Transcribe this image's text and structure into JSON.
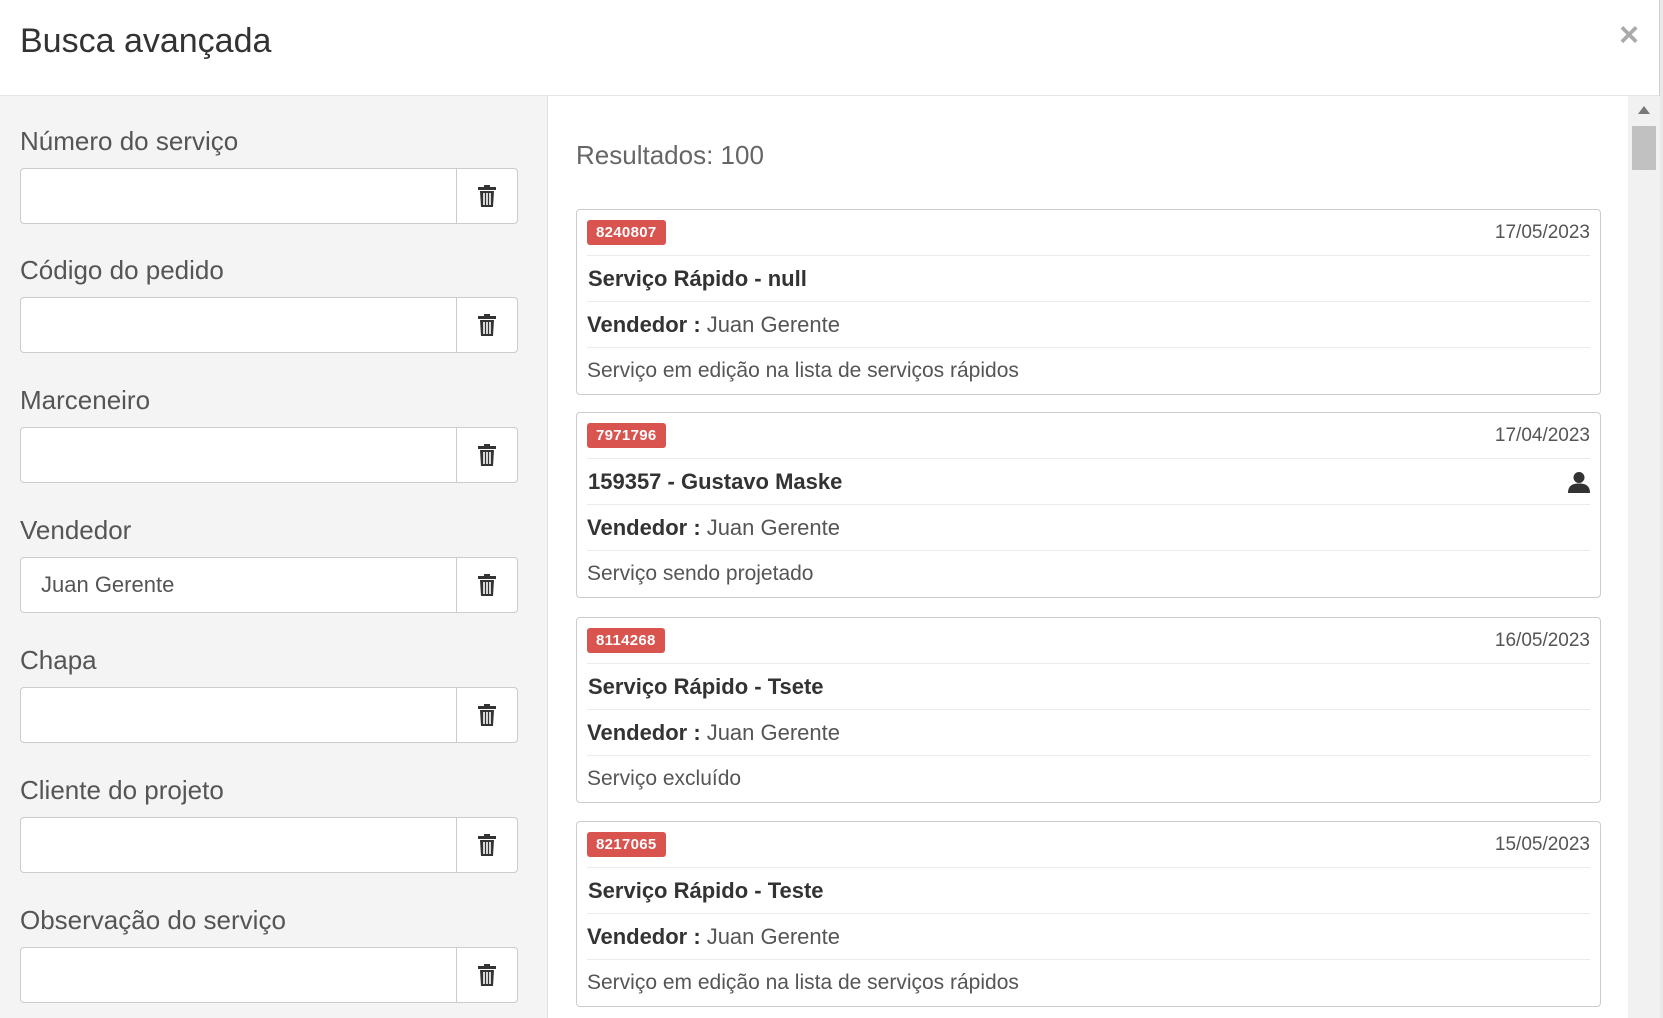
{
  "modal": {
    "title": "Busca avançada",
    "close_label": "×"
  },
  "filters": [
    {
      "label": "Número do serviço",
      "value": ""
    },
    {
      "label": "Código do pedido",
      "value": ""
    },
    {
      "label": "Marceneiro",
      "value": ""
    },
    {
      "label": "Vendedor",
      "value": "Juan Gerente"
    },
    {
      "label": "Chapa",
      "value": ""
    },
    {
      "label": "Cliente do projeto",
      "value": ""
    },
    {
      "label": "Observação do serviço",
      "value": ""
    }
  ],
  "results": {
    "count_label": "Resultados: 100",
    "seller_label": "Vendedor :",
    "items": [
      {
        "id": "8240807",
        "date": "17/05/2023",
        "title": "Serviço Rápido - null",
        "seller": "Juan Gerente",
        "status": "Serviço em edição na lista de serviços rápidos",
        "user_icon": false
      },
      {
        "id": "7971796",
        "date": "17/04/2023",
        "title": "159357 - Gustavo Maske",
        "seller": "Juan Gerente",
        "status": "Serviço sendo projetado",
        "user_icon": true
      },
      {
        "id": "8114268",
        "date": "16/05/2023",
        "title": "Serviço Rápido - Tsete",
        "seller": "Juan Gerente",
        "status": "Serviço excluído",
        "user_icon": false
      },
      {
        "id": "8217065",
        "date": "15/05/2023",
        "title": "Serviço Rápido - Teste",
        "seller": "Juan Gerente",
        "status": "Serviço em edição na lista de serviços rápidos",
        "user_icon": false
      }
    ]
  },
  "colors": {
    "badge": "#d9534f",
    "sidebar_bg": "#f4f4f4"
  },
  "icons": {
    "clear": "trash-icon",
    "client": "user-icon",
    "close": "close-icon"
  }
}
